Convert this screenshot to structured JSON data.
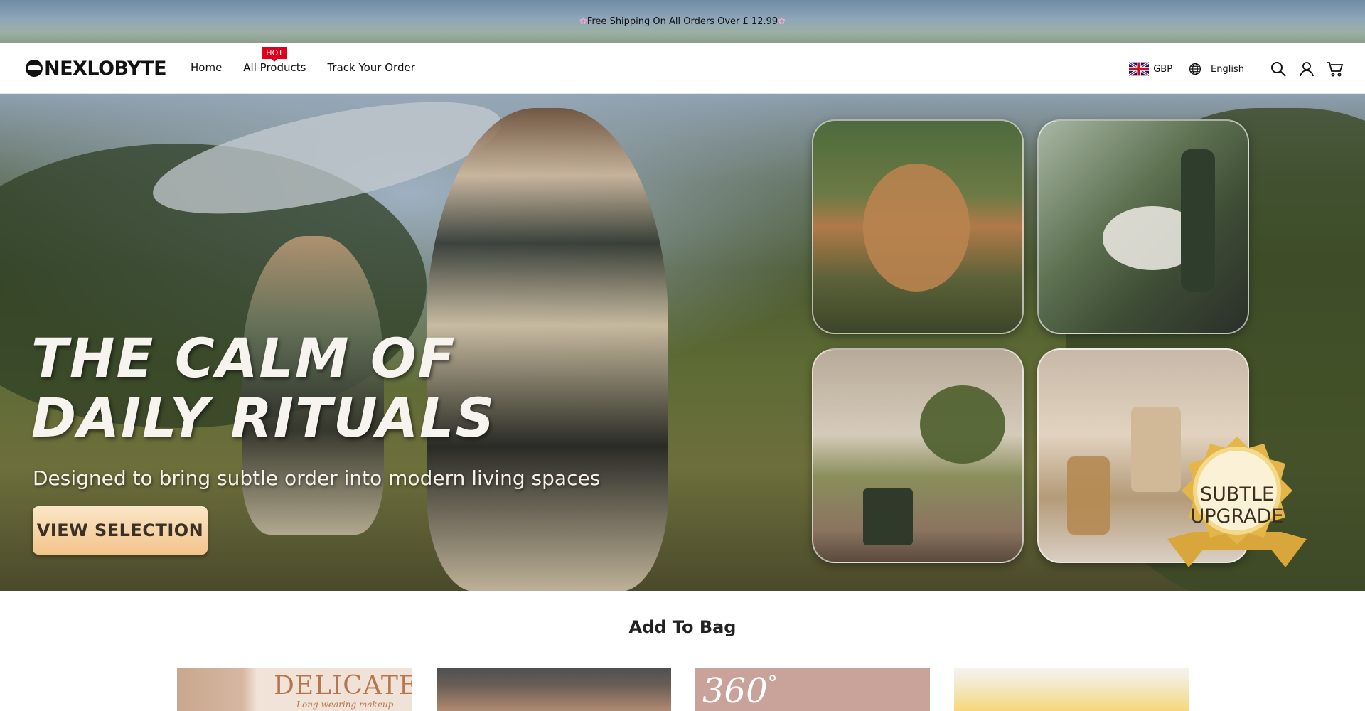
{
  "announcement": {
    "text": "Free Shipping On All Orders Over  £ 12.99",
    "icon": "flower-icon"
  },
  "header": {
    "logo_text": "NEXLOBYTE",
    "nav": [
      {
        "label": "Home"
      },
      {
        "label": "All Products",
        "badge": "HOT"
      },
      {
        "label": "Track Your Order"
      }
    ],
    "currency": "GBP",
    "language": "English",
    "icons": [
      "search-icon",
      "account-icon",
      "cart-icon"
    ]
  },
  "hero": {
    "title_line1": "THE CALM OF",
    "title_line2": "DAILY RITUALS",
    "subtitle": "Designed to bring subtle order into modern living spaces",
    "cta_label": "VIEW SELECTION",
    "seal_line1": "SUBTLE",
    "seal_line2": "UPGRADE"
  },
  "section": {
    "title": "Add To Bag",
    "cards": [
      {
        "text": "DELICATE",
        "subtext": "Long-wearing makeup"
      },
      {
        "text": ""
      },
      {
        "text": "360",
        "suffix": "°"
      },
      {
        "text": ""
      }
    ]
  },
  "colors": {
    "hot_badge": "#e0001b",
    "cta_gradient_top": "#fbe6c8",
    "cta_gradient_bottom": "#f2c48a"
  }
}
